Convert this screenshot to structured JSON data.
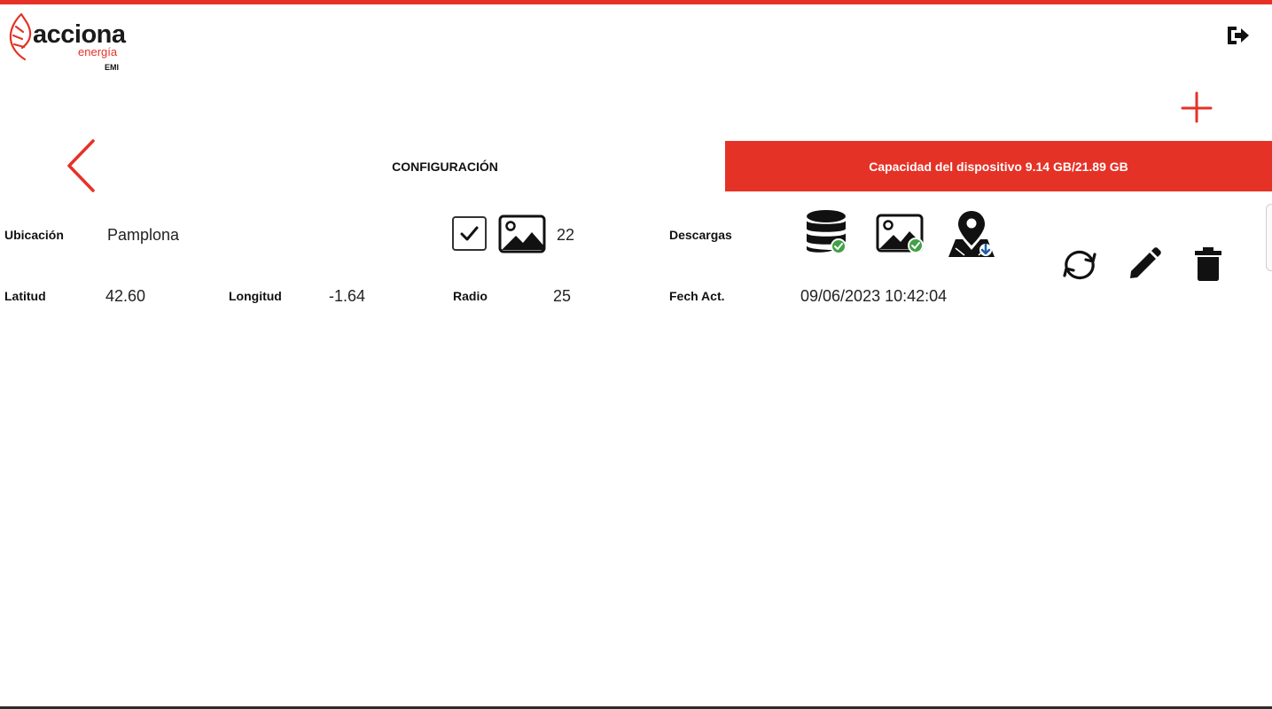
{
  "header": {
    "brand": "acciona",
    "brand_sub": "energía",
    "app_name": "EMI",
    "accent_color": "#e53226"
  },
  "tabs": {
    "config_label": "CONFIGURACIÓN",
    "capacity_label": "Capacidad del dispositivo 9.14 GB/21.89 GB"
  },
  "location": {
    "ubicacion_label": "Ubicación",
    "ubicacion_value": "Pamplona",
    "image_count": "22",
    "latitud_label": "Latitud",
    "latitud_value": "42.60",
    "longitud_label": "Longitud",
    "longitud_value": "-1.64",
    "radio_label": "Radio",
    "radio_value": "25",
    "descargas_label": "Descargas",
    "fecha_label": "Fech Act.",
    "fecha_value": "09/06/2023 10:42:04"
  },
  "icons": {
    "logout": "logout-icon",
    "add": "plus-icon",
    "back": "chevron-left-icon",
    "checkbox": "checkbox-checked-icon",
    "image": "image-icon",
    "database": "database-check-icon",
    "image_download": "image-check-icon",
    "map_download": "map-pin-download-icon",
    "sync": "sync-icon",
    "edit": "pencil-icon",
    "delete": "trash-icon"
  }
}
